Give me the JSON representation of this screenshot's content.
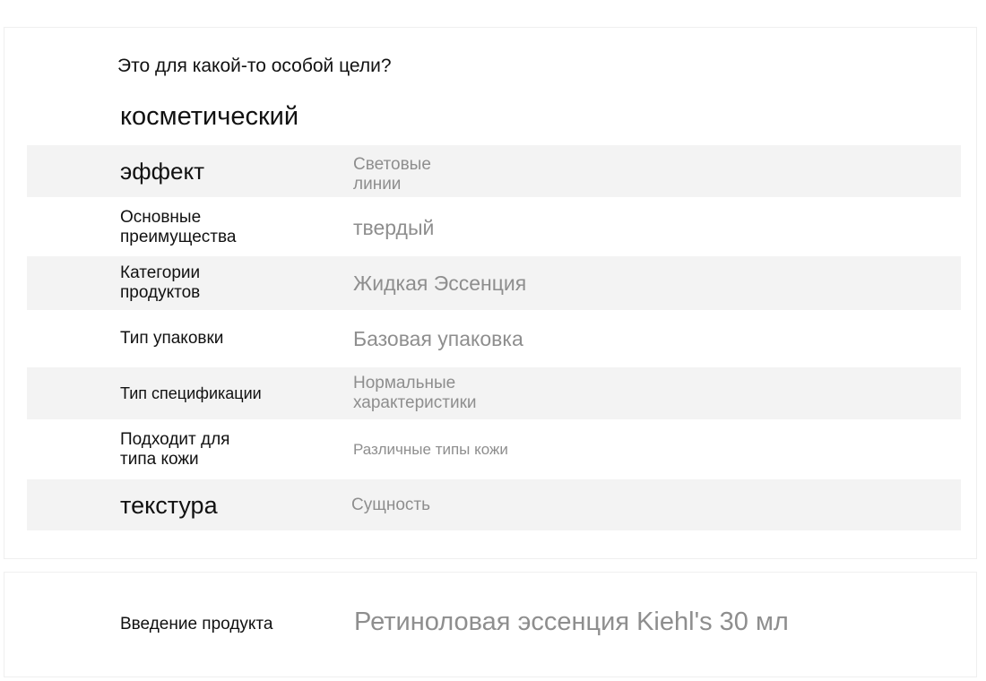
{
  "header": {
    "question": "Это для какой-то особой цели?",
    "purpose": "косметический"
  },
  "attributes": [
    {
      "label": "эффект",
      "value": "Световые линии"
    },
    {
      "label": "Основные преимущества",
      "value": "твердый"
    },
    {
      "label": "Категории продуктов",
      "value": "Жидкая Эссенция"
    },
    {
      "label": "Тип упаковки",
      "value": "Базовая упаковка"
    },
    {
      "label": "Тип спецификации",
      "value": "Нормальные характеристики"
    },
    {
      "label": "Подходит для типа кожи",
      "value": "Различные типы кожи"
    },
    {
      "label": "текстура",
      "value": "Сущность"
    }
  ],
  "introduction": {
    "label": "Введение продукта",
    "value": "Ретиноловая эссенция Kiehl's 30 мл"
  },
  "colors": {
    "label_text": "#111111",
    "value_text": "#8e8e8e",
    "row_shade": "#f3f3f3"
  }
}
